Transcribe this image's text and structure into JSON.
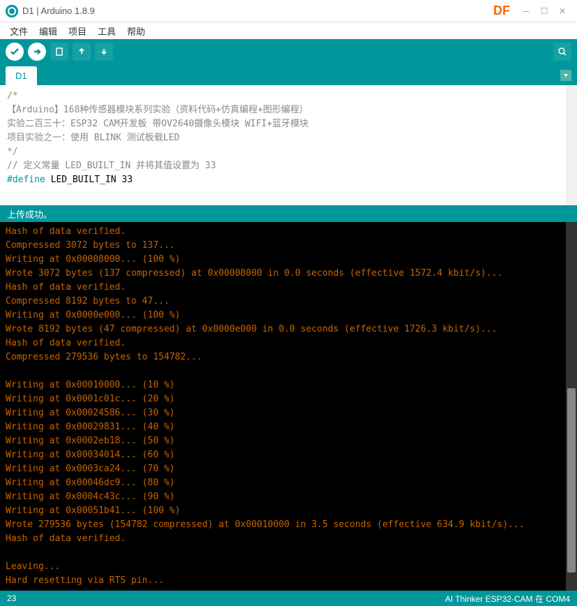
{
  "title": "D1 | Arduino 1.8.9",
  "df_label": "DF",
  "menu": {
    "file": "文件",
    "edit": "编辑",
    "project": "项目",
    "tools": "工具",
    "help": "帮助"
  },
  "tab": {
    "name": "D1"
  },
  "code": {
    "l1": "/*",
    "l2": "  【Arduino】168种传感器模块系列实验（资料代码+仿真编程+图形编程）",
    "l3": "   实验二百三十：ESP32 CAM开发板 带OV2640摄像头模块 WIFI+蓝牙模块",
    "l4": "   项目实验之一：使用 BLINK 测试板载LED",
    "l5": "*/",
    "l6": "",
    "l7": "// 定义常量 LED_BUILT_IN 并将其值设置为 33",
    "l8a": "#define",
    "l8b": " LED_BUILT_IN 33"
  },
  "status_msg": "上传成功。",
  "console_text": "Hash of data verified.\nCompressed 3072 bytes to 137...\nWriting at 0x00008000... (100 %)\nWrote 3072 bytes (137 compressed) at 0x00008000 in 0.0 seconds (effective 1572.4 kbit/s)...\nHash of data verified.\nCompressed 8192 bytes to 47...\nWriting at 0x0000e000... (100 %)\nWrote 8192 bytes (47 compressed) at 0x0000e000 in 0.0 seconds (effective 1726.3 kbit/s)...\nHash of data verified.\nCompressed 279536 bytes to 154782...\n\nWriting at 0x00010000... (10 %)\nWriting at 0x0001c01c... (20 %)\nWriting at 0x00024586... (30 %)\nWriting at 0x00029831... (40 %)\nWriting at 0x0002eb18... (50 %)\nWriting at 0x00034014... (60 %)\nWriting at 0x0003ca24... (70 %)\nWriting at 0x00046dc9... (80 %)\nWriting at 0x0004c43c... (90 %)\nWriting at 0x00051b41... (100 %)\nWrote 279536 bytes (154782 compressed) at 0x00010000 in 3.5 seconds (effective 634.9 kbit/s)...\nHash of data verified.\n\nLeaving...\nHard resetting via RTS pin...",
  "bottom": {
    "line": "23",
    "board": "AI Thinker ESP32-CAM 在 COM4"
  }
}
